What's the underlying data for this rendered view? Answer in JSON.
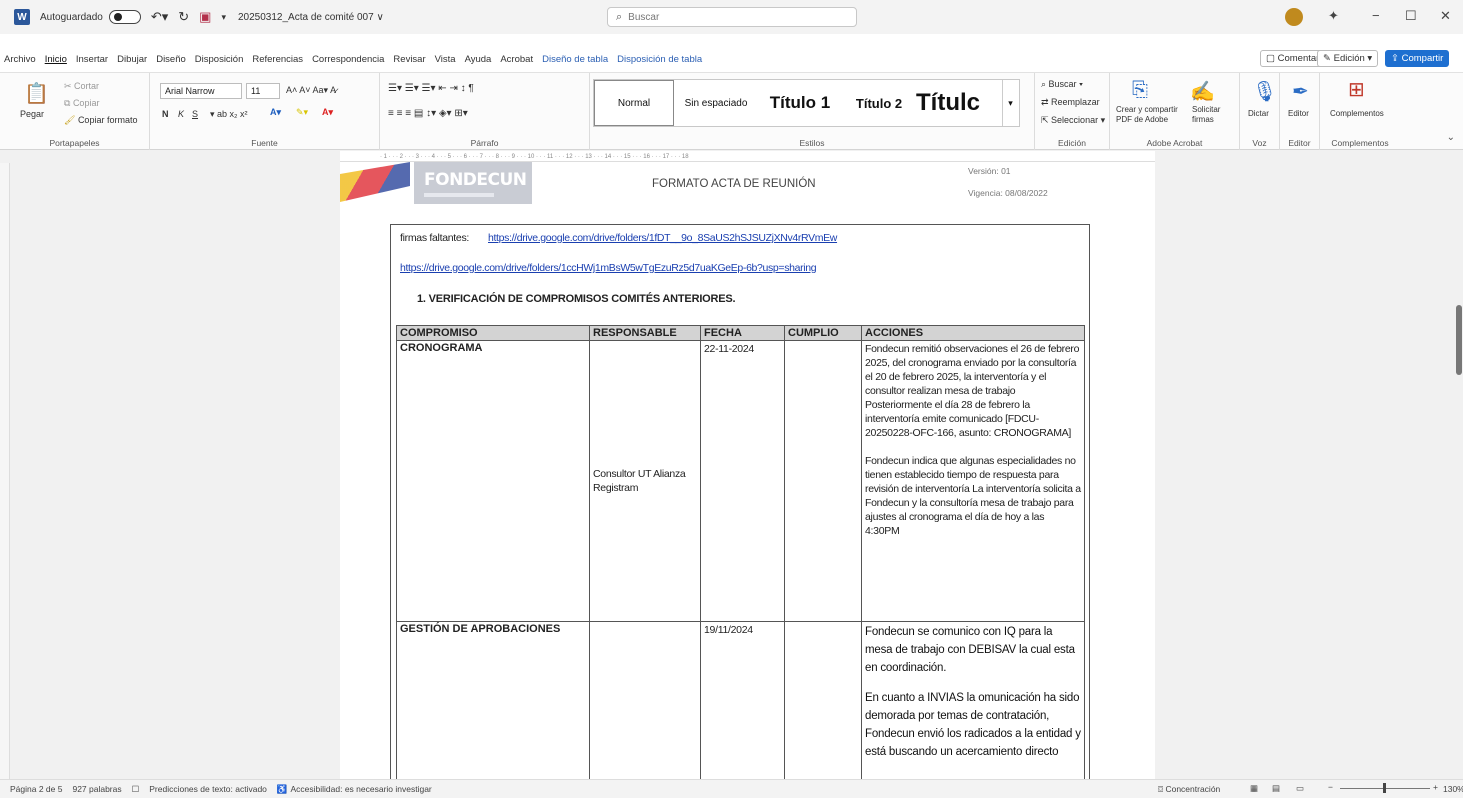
{
  "titlebar": {
    "autosave_label": "Autoguardado",
    "doc_name": "20250312_Acta de comité 007 ∨",
    "search_placeholder": "Buscar",
    "minimize": "−",
    "maximize": "☐",
    "close": "✕"
  },
  "ribbon_tabs": [
    "Archivo",
    "Inicio",
    "Insertar",
    "Dibujar",
    "Diseño",
    "Disposición",
    "Referencias",
    "Correspondencia",
    "Revisar",
    "Vista",
    "Ayuda",
    "Acrobat",
    "Diseño de tabla",
    "Disposición de tabla"
  ],
  "ribbon_right": {
    "comments": "Comentarios",
    "editing": "Edición",
    "share": "Compartir"
  },
  "ribbon": {
    "clipboard": {
      "paste": "Pegar",
      "cut": "Cortar",
      "copy": "Copiar",
      "format_painter": "Copiar formato",
      "label": "Portapapeles"
    },
    "font": {
      "name": "Arial Narrow",
      "size": "11",
      "bold": "N",
      "italic": "K",
      "underline": "S",
      "label": "Fuente"
    },
    "paragraph": {
      "label": "Párrafo"
    },
    "styles": {
      "normal": "Normal",
      "no_spacing": "Sin espaciado",
      "title1": "Título 1",
      "title2": "Título 2",
      "title": "Títulc",
      "label": "Estilos"
    },
    "editing": {
      "find": "Buscar",
      "replace": "Reemplazar",
      "select": "Seleccionar",
      "label": "Edición"
    },
    "acrobat": {
      "create_share": "Crear y compartir PDF de Adobe",
      "request_signatures": "Solicitar firmas",
      "label": "Adobe Acrobat"
    },
    "voice": {
      "dictate": "Dictar",
      "label": "Voz"
    },
    "editor": {
      "editor": "Editor",
      "label": "Editor"
    },
    "addins": {
      "addins": "Complementos",
      "label": "Complementos"
    }
  },
  "document": {
    "header": {
      "logo": "FONDECUN",
      "title": "FORMATO ACTA DE REUNIÓN",
      "version": "Versión: 01",
      "validity": "Vigencia: 08/08/2022"
    },
    "missing_signatures_label": "firmas faltantes:",
    "link1": "https://drive.google.com/drive/folders/1fDT__9o_8SaUS2hSJSUZjXNv4rRVmEw",
    "link2": "https://drive.google.com/drive/folders/1ccHWj1mBsW5wTgEzuRz5d7uaKGeEp-6b?usp=sharing",
    "section_title": "1.   VERIFICACIÓN DE COMPROMISOS COMITÉS ANTERIORES.",
    "table": {
      "headers": [
        "COMPROMISO",
        "RESPONSABLE",
        "FECHA",
        "CUMPLIO",
        "ACCIONES"
      ],
      "row1": {
        "compromiso": "CRONOGRAMA",
        "responsable": "Consultor UT Alianza Registram",
        "fecha": "22-11-2024",
        "cumplio": "",
        "acciones_p1": "Fondecun remitió observaciones el 26 de febrero 2025, del cronograma enviado por la consultoría el 20 de febrero 2025, la interventoría y el consultor realizan mesa de trabajo Posteriormente el día 28 de febrero la interventoría emite comunicado [FDCU-20250228-OFC-166, asunto: CRONOGRAMA]",
        "acciones_p2": "Fondecun indica que algunas especialidades no tienen establecido tiempo de respuesta para revisión de interventoría La interventoría solicita a Fondecun y la consultoría mesa de trabajo para ajustes al cronograma el día de hoy a las 4:30PM"
      },
      "row2": {
        "compromiso": "GESTIÓN DE APROBACIONES",
        "responsable": "",
        "fecha": "19/11/2024",
        "cumplio": "",
        "acciones_p1": "Fondecun se comunico con IQ para la mesa de trabajo con DEBISAV la cual esta en coordinación.",
        "acciones_p2": "En cuanto a INVIAS la omunicación ha sido demorada por temas de contratación, Fondecun envió los radicados a la entidad y está buscando un acercamiento directo"
      }
    }
  },
  "statusbar": {
    "page": "Página 2 de 5",
    "words": "927 palabras",
    "predictions": "Predicciones de texto: activado",
    "accessibility": "Accesibilidad: es necesario investigar",
    "focus": "Concentración",
    "zoom": "130%"
  }
}
